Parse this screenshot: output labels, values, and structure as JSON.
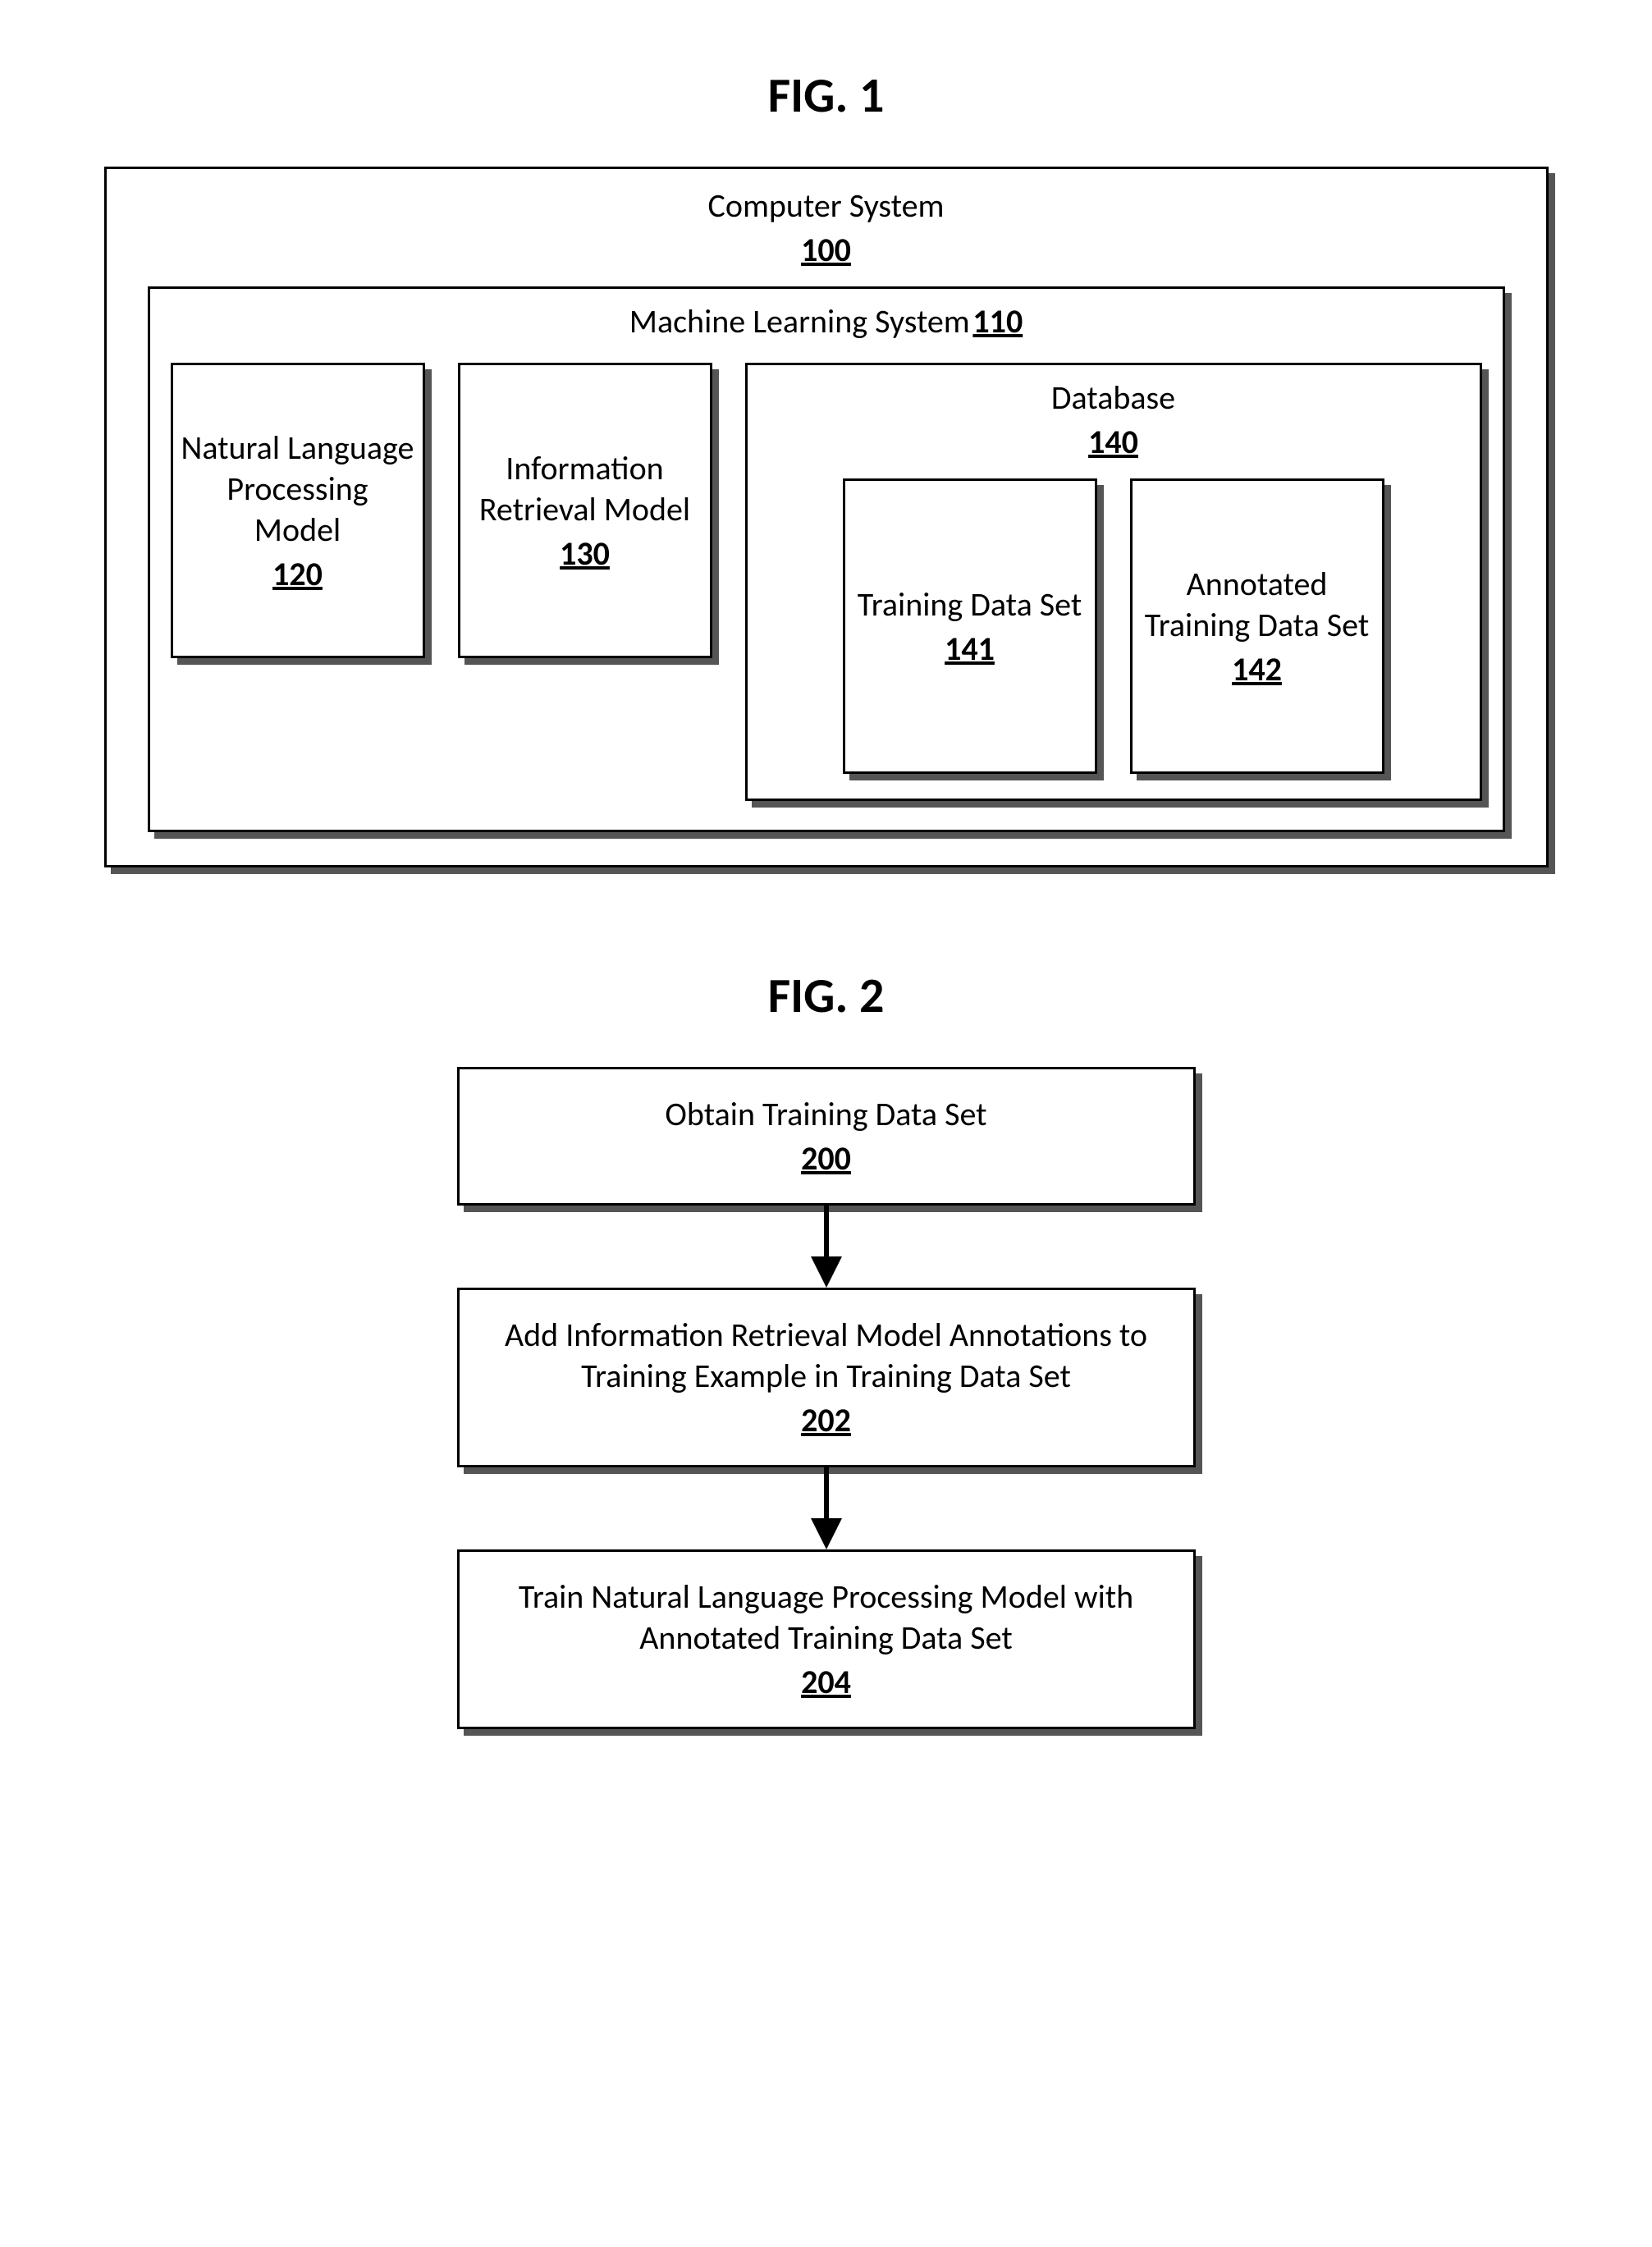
{
  "fig1": {
    "title": "FIG. 1",
    "outer": {
      "label": "Computer System",
      "ref": "100"
    },
    "ml": {
      "label": "Machine Learning System",
      "ref": "110"
    },
    "nlp": {
      "label": "Natural Language Processing Model",
      "ref": "120"
    },
    "ir": {
      "label": "Information Retrieval Model",
      "ref": "130"
    },
    "db": {
      "label": "Database",
      "ref": "140"
    },
    "tds": {
      "label": "Training Data Set",
      "ref": "141"
    },
    "atds": {
      "label": "Annotated Training Data Set",
      "ref": "142"
    }
  },
  "fig2": {
    "title": "FIG. 2",
    "step1": {
      "label": "Obtain Training Data Set",
      "ref": "200"
    },
    "step2": {
      "label": "Add Information Retrieval Model Annotations to Training Example in Training Data Set",
      "ref": "202"
    },
    "step3": {
      "label": "Train Natural Language Processing Model with Annotated Training Data Set",
      "ref": "204"
    }
  }
}
